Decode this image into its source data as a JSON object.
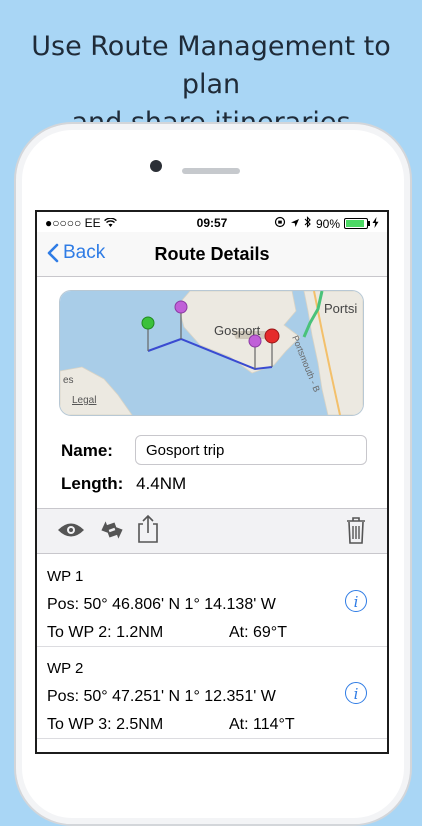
{
  "caption": {
    "line1": "Use Route Management to plan",
    "line2": "and share itineraries"
  },
  "status_bar": {
    "carrier": "●○○○○ EE",
    "time": "09:57",
    "battery_percent": 90,
    "battery_label": "90%"
  },
  "nav": {
    "back_label": "Back",
    "title": "Route Details"
  },
  "map": {
    "labels": {
      "gosport": "Gosport",
      "portsmouth": "Portsmouth - B",
      "portsi": "Portsi",
      "es": "es",
      "legal": "Legal"
    }
  },
  "form": {
    "name_label": "Name:",
    "name_value": "Gosport trip",
    "length_label": "Length:",
    "length_value": "4.4NM"
  },
  "toolbar": {
    "icons": [
      "eye-icon",
      "swap-icon",
      "share-icon",
      "trash-icon"
    ]
  },
  "waypoints": [
    {
      "title": "WP 1",
      "pos": "Pos: 50° 46.806' N 1° 14.138' W",
      "to": "To WP 2: 1.2NM",
      "at": "At: 69°T"
    },
    {
      "title": "WP 2",
      "pos": "Pos: 50° 47.251' N 1° 12.351' W",
      "to": "To WP 3: 2.5NM",
      "at": "At: 114°T"
    }
  ],
  "colors": {
    "accent": "#2f7ce5",
    "background": "#a9d6f5",
    "route": "#3a4bd1"
  }
}
